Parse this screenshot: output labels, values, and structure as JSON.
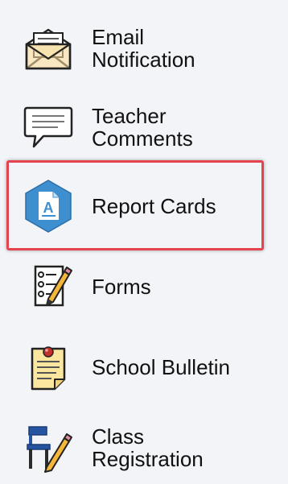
{
  "nav": {
    "items": [
      {
        "id": "email",
        "label": "Email\nNotification",
        "icon": "envelope-icon"
      },
      {
        "id": "comments",
        "label": "Teacher\nComments",
        "icon": "speech-bubble-icon"
      },
      {
        "id": "report",
        "label": "Report Cards",
        "icon": "report-card-hexagon-icon",
        "selected": true
      },
      {
        "id": "forms",
        "label": "Forms",
        "icon": "checklist-pencil-icon"
      },
      {
        "id": "bulletin",
        "label": "School Bulletin",
        "icon": "pinned-note-icon"
      },
      {
        "id": "registration",
        "label": "Class\nRegistration",
        "icon": "desk-chair-pencil-icon"
      }
    ]
  },
  "colors": {
    "background": "#f2f4f8",
    "highlight_border": "#e5434f",
    "report_icon_blue": "#3e8fd0"
  }
}
